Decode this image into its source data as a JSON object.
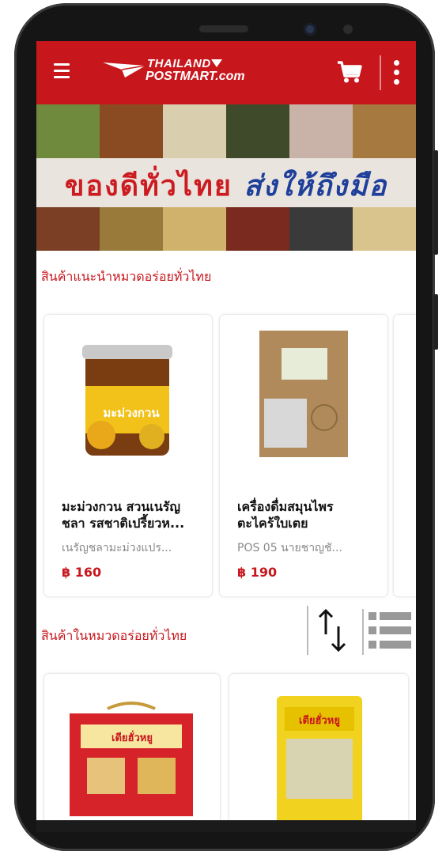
{
  "header": {
    "logo_line1": "THAILAND",
    "logo_line2": "POSTMART.com",
    "menu_icon": "hamburger-icon",
    "cart_icon": "cart-icon",
    "more_icon": "kebab-menu-icon"
  },
  "banner": {
    "text_red": "ของดีทั่วไทย",
    "text_blue": "ส่งให้ถึงมือ"
  },
  "recommended": {
    "title": "สินค้าแนะนำหมวดอร่อยทั่วไทย",
    "products": [
      {
        "name": "มะม่วงกวน สวนเนรัญชลา รสชาติเปรี้ยวห...",
        "seller": "เนรัญชลามะม่วงแปร...",
        "price": "฿ 160",
        "package_label": "มะม่วงกวน"
      },
      {
        "name": "เครื่องดื่มสมุนไพร ตะไคร้ใบเตย",
        "seller": "POS 05 นายชาญชั...",
        "price": "฿ 190"
      }
    ]
  },
  "category": {
    "title": "สินค้าในหมวดอร่อยทั่วไทย",
    "sort_icon": "sort-icon",
    "view_icon": "list-view-icon",
    "product_labels": [
      "เตียฮั่วหยู",
      "เตียฮั่วหยู"
    ]
  },
  "colors": {
    "brand_red": "#c7171d",
    "price_red": "#c7171d",
    "banner_blue": "#1e3f9a",
    "seller_gray": "#888888"
  }
}
